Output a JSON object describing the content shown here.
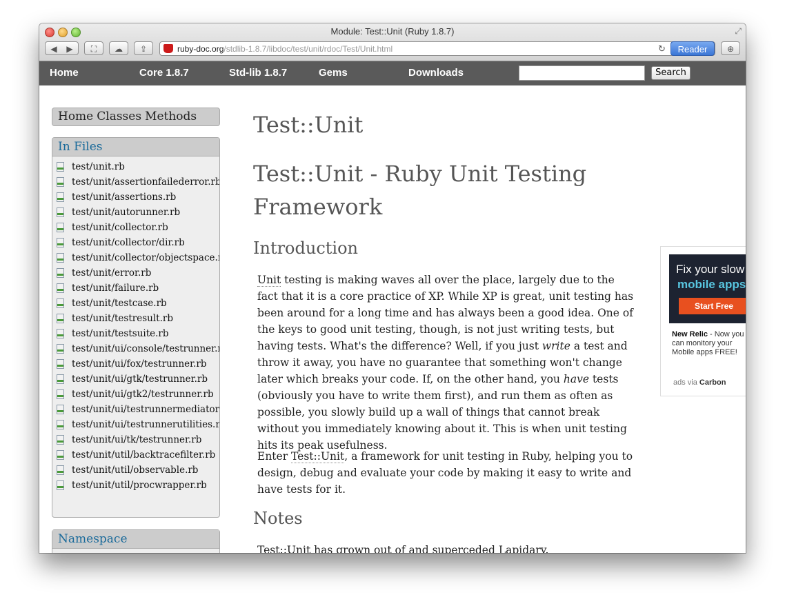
{
  "browser": {
    "title": "Module: Test::Unit (Ruby 1.8.7)",
    "url_domain": "ruby-doc.org",
    "url_path": "/stdlib-1.8.7/libdoc/test/unit/rdoc/Test/Unit.html",
    "reader_label": "Reader",
    "back_glyph": "◀",
    "forward_glyph": "▶",
    "reload_glyph": "↻",
    "fullscreen_glyph": "⛶",
    "cloud_glyph": "☁",
    "share_glyph": "⇪",
    "download_glyph": "⊕",
    "resize_glyph": "⤢"
  },
  "nav": {
    "home": "Home",
    "core": "Core 1.8.7",
    "stdlib": "Std-lib 1.8.7",
    "gems": "Gems",
    "downloads": "Downloads",
    "search_value": "",
    "search_button": "Search"
  },
  "sidebar": {
    "home": "Home",
    "classes": "Classes",
    "methods": "Methods",
    "in_files_title": "In Files",
    "namespace_title": "Namespace",
    "files": [
      "test/unit.rb",
      "test/unit/assertionfailederror.rb",
      "test/unit/assertions.rb",
      "test/unit/autorunner.rb",
      "test/unit/collector.rb",
      "test/unit/collector/dir.rb",
      "test/unit/collector/objectspace.rb",
      "test/unit/error.rb",
      "test/unit/failure.rb",
      "test/unit/testcase.rb",
      "test/unit/testresult.rb",
      "test/unit/testsuite.rb",
      "test/unit/ui/console/testrunner.rb",
      "test/unit/ui/fox/testrunner.rb",
      "test/unit/ui/gtk/testrunner.rb",
      "test/unit/ui/gtk2/testrunner.rb",
      "test/unit/ui/testrunnermediator.rb",
      "test/unit/ui/testrunnerutilities.rb",
      "test/unit/ui/tk/testrunner.rb",
      "test/unit/util/backtracefilter.rb",
      "test/unit/util/observable.rb",
      "test/unit/util/procwrapper.rb"
    ]
  },
  "main": {
    "title": "Test::Unit",
    "subtitle": "Test::Unit - Ruby Unit Testing Framework",
    "intro_heading": "Introduction",
    "p1": {
      "a": "Unit",
      "b": " testing is making waves all over the place, largely due to the fact that it is a core practice of XP. While XP is great, unit testing has been around for a long time and has always been a good idea. One of the keys to good unit testing, though, is not just writing tests, but having tests. What's the difference? Well, if you just ",
      "c": "write",
      "d": " a test and throw it away, you have no guarantee that something won't change later which breaks your code. If, on the other hand, you ",
      "e": "have",
      "f": " tests (obviously you have to write them first), and run them as often as possible, you slowly build up a wall of things that cannot break without you immediately knowing about it. This is when unit testing hits its peak usefulness."
    },
    "p2": {
      "a": "Enter ",
      "b": "Test::Unit",
      "c": ", a framework for unit testing in Ruby, helping you to design, debug and evaluate your code by making it easy to write and have tests for it."
    },
    "notes_heading": "Notes",
    "p3": "Test::Unit has grown out of and superceded Lapidary."
  },
  "ad": {
    "line1": "Fix your slow",
    "line2": "mobile apps",
    "cta": "Start Free",
    "brand": "New Relic",
    "text1": " - Now you",
    "text2": "can monitory your",
    "text3": "Mobile apps FREE!",
    "via": "ads via ",
    "carbon": "Carbon"
  },
  "colors": {
    "nav_bg": "#5a5a5a",
    "link": "#1a6a9a",
    "reader": "#3b76d6",
    "close_light": "#d8392f",
    "min_light": "#e0a02a",
    "max_light": "#5fb32f",
    "ad_cta": "#e8501f"
  }
}
